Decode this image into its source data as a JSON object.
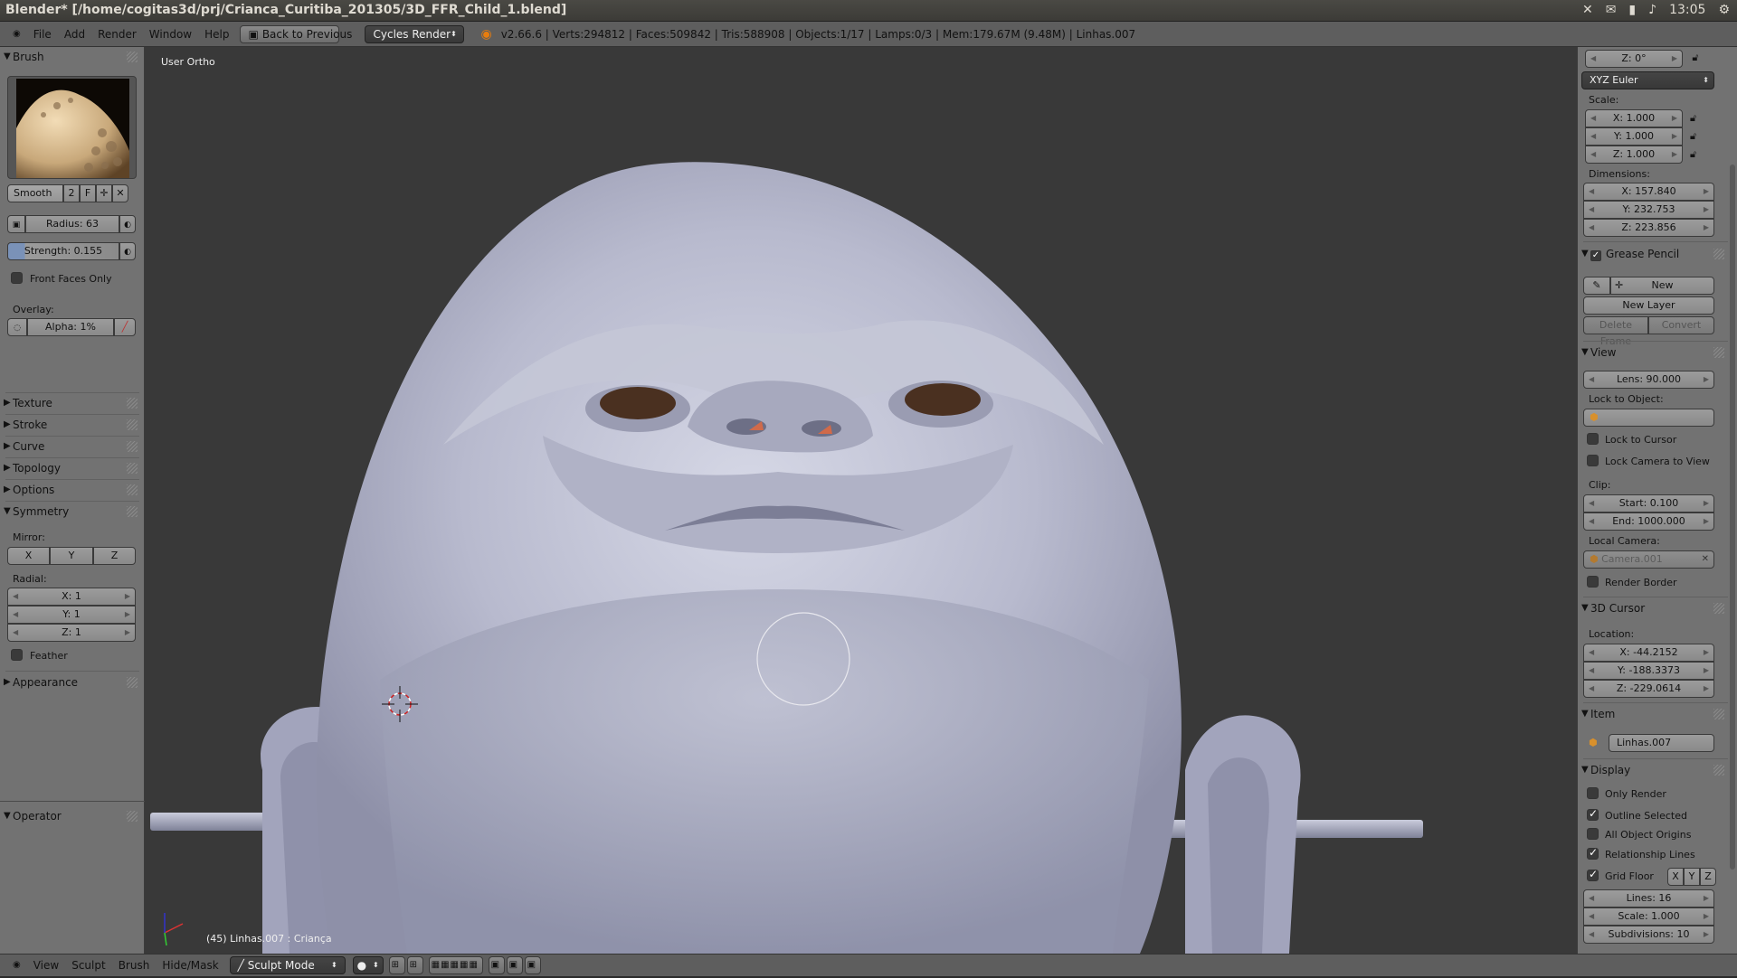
{
  "os": {
    "title": "Blender* [/home/cogitas3d/prj/Crianca_Curitiba_201305/3D_FFR_Child_1.blend]",
    "time": "13:05"
  },
  "header": {
    "menus": [
      "File",
      "Add",
      "Render",
      "Window",
      "Help"
    ],
    "back_button": "Back to Previous",
    "render_engine": "Cycles Render",
    "stats": "v2.66.6 | Verts:294812 | Faces:509842 | Tris:588908 | Objects:1/17 | Lamps:0/3 | Mem:179.67M (9.48M) | Linhas.007"
  },
  "left": {
    "brush_title": "Brush",
    "brush_name": "Smooth",
    "brush_users": "2",
    "fake_user": "F",
    "radius": "Radius: 63",
    "strength": "Strength: 0.155",
    "front_faces": "Front Faces Only",
    "overlay_label": "Overlay:",
    "alpha": "Alpha: 1%",
    "texture": "Texture",
    "stroke": "Stroke",
    "curve": "Curve",
    "topology": "Topology",
    "options": "Options",
    "symmetry": "Symmetry",
    "mirror_label": "Mirror:",
    "mirror_x": "X",
    "mirror_y": "Y",
    "mirror_z": "Z",
    "radial_label": "Radial:",
    "radial_x": "X: 1",
    "radial_y": "Y: 1",
    "radial_z": "Z: 1",
    "feather": "Feather",
    "appearance": "Appearance",
    "operator": "Operator"
  },
  "viewport": {
    "view_label": "User Ortho",
    "object_info": "(45) Linhas.007 : Criança"
  },
  "right": {
    "rot_z": "Z: 0°",
    "rotation_mode": "XYZ Euler",
    "scale_label": "Scale:",
    "scale_x": "X: 1.000",
    "scale_y": "Y: 1.000",
    "scale_z": "Z: 1.000",
    "dimensions_label": "Dimensions:",
    "dim_x": "X: 157.840",
    "dim_y": "Y: 232.753",
    "dim_z": "Z: 223.856",
    "grease_pencil": "Grease Pencil",
    "gp_new": "New",
    "gp_new_layer": "New Layer",
    "gp_delete_frame": "Delete Frame",
    "gp_convert": "Convert",
    "view": "View",
    "lens": "Lens: 90.000",
    "lock_to_object": "Lock to Object:",
    "lock_to_cursor": "Lock to Cursor",
    "lock_camera": "Lock Camera to View",
    "clip_label": "Clip:",
    "clip_start": "Start: 0.100",
    "clip_end": "End: 1000.000",
    "local_camera_label": "Local Camera:",
    "local_camera": "Camera.001",
    "render_border": "Render Border",
    "cursor_3d": "3D Cursor",
    "location_label": "Location:",
    "loc_x": "X: -44.2152",
    "loc_y": "Y: -188.3373",
    "loc_z": "Z: -229.0614",
    "item": "Item",
    "item_name": "Linhas.007",
    "display": "Display",
    "only_render": "Only Render",
    "outline_selected": "Outline Selected",
    "all_object_origins": "All Object Origins",
    "relationship_lines": "Relationship Lines",
    "grid_floor": "Grid Floor",
    "grid_x": "X",
    "grid_y": "Y",
    "grid_z": "Z",
    "lines": "Lines: 16",
    "scale": "Scale: 1.000",
    "subdivisions": "Subdivisions: 10"
  },
  "footer": {
    "menus": [
      "View",
      "Sculpt",
      "Brush",
      "Hide/Mask"
    ],
    "mode": "Sculpt Mode"
  },
  "colors": {
    "panel": "#727272",
    "header": "#5e5e5e",
    "viewport": "#393939",
    "mesh": "#b4b6c8"
  }
}
